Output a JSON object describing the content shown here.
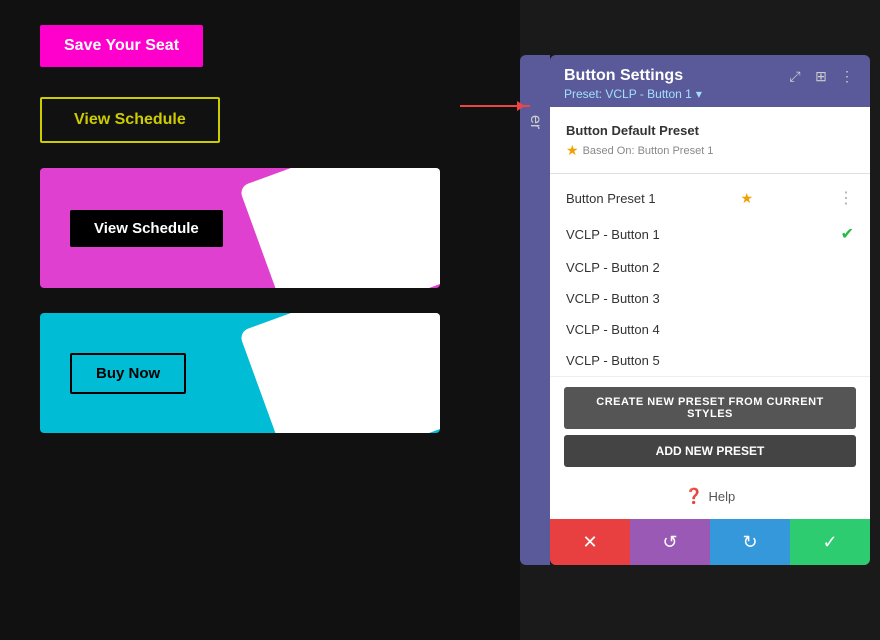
{
  "canvas": {
    "buttons": {
      "save_seat_label": "Save Your Seat",
      "view_schedule_outline_label": "View Schedule",
      "view_schedule_banner_label": "View Schedule",
      "buy_now_label": "Buy Now"
    }
  },
  "panel": {
    "title": "Button Settings",
    "preset_label": "Preset: VCLP - Button 1",
    "dropdown_chevron": "▾",
    "header_icons": {
      "expand": "⤢",
      "columns": "⊞",
      "more": "⋮"
    },
    "default_preset_section": "Button Default Preset",
    "based_on": "Based On: Button Preset 1",
    "preset_1_label": "Button Preset 1",
    "items": [
      {
        "label": "VCLP - Button 1",
        "selected": true
      },
      {
        "label": "VCLP - Button 2",
        "selected": false
      },
      {
        "label": "VCLP - Button 3",
        "selected": false
      },
      {
        "label": "VCLP - Button 4",
        "selected": false
      },
      {
        "label": "VCLP - Button 5",
        "selected": false
      }
    ],
    "create_preset_label": "CREATE NEW PRESET FROM CURRENT STYLES",
    "add_preset_label": "ADD NEW PRESET",
    "help_label": "Help",
    "bottom_bar": {
      "cancel_icon": "✕",
      "undo_icon": "↺",
      "redo_icon": "↻",
      "confirm_icon": "✓"
    }
  }
}
